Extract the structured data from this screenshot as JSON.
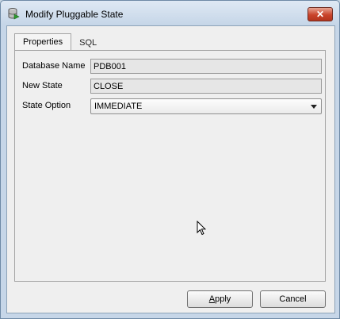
{
  "window": {
    "title": "Modify Pluggable State",
    "close_glyph": "✕"
  },
  "tabs": [
    {
      "label": "Properties",
      "active": true
    },
    {
      "label": "SQL",
      "active": false
    }
  ],
  "form": {
    "database_name": {
      "label": "Database Name",
      "value": "PDB001"
    },
    "new_state": {
      "label": "New State",
      "value": "CLOSE"
    },
    "state_option": {
      "label": "State Option",
      "value": "IMMEDIATE"
    }
  },
  "buttons": {
    "apply_mnemonic": "A",
    "apply_rest": "pply",
    "cancel": "Cancel"
  },
  "icons": {
    "title": "database-icon",
    "close": "close-icon",
    "dropdown": "chevron-down-icon",
    "cursor": "mouse-pointer-icon"
  },
  "colors": {
    "close_button": "#c9442b",
    "title_bar": "#c6d6e8",
    "client_bg": "#efefef"
  }
}
